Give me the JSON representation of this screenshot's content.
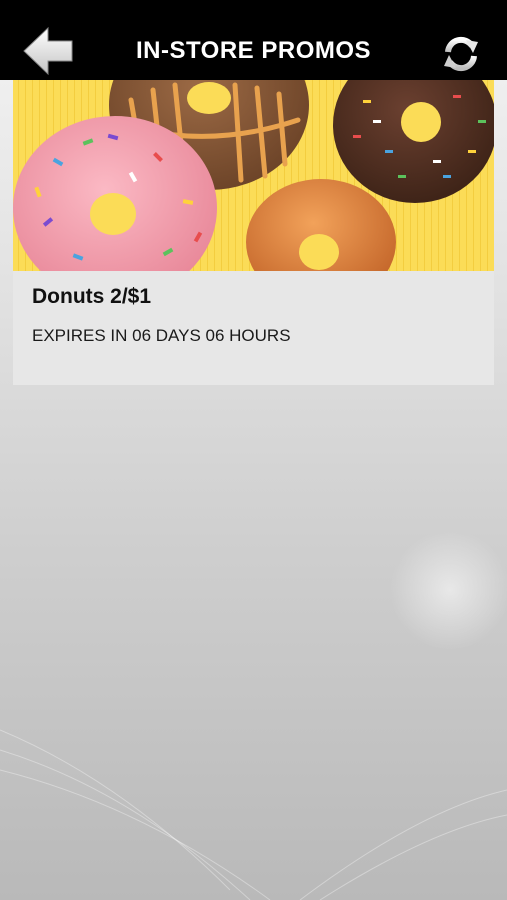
{
  "header": {
    "title": "IN-STORE PROMOS",
    "back_icon": "arrow-left-icon",
    "refresh_icon": "refresh-icon"
  },
  "promos": [
    {
      "title": "Donuts 2/$1",
      "expiry": "EXPIRES IN 06 DAYS 06 HOURS",
      "image": "donuts-photo"
    }
  ],
  "colors": {
    "header_bg": "#000000",
    "card_bg": "#e7e7e7",
    "image_bg": "#fbdc57"
  }
}
